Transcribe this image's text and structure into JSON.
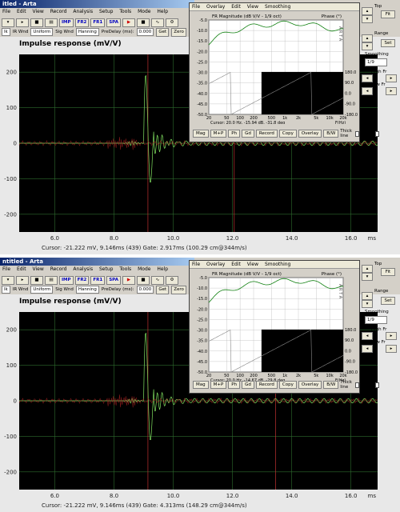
{
  "panels": [
    {
      "window_title": "itled - Arta",
      "menu": [
        "File",
        "Edit",
        "View",
        "Record",
        "Analysis",
        "Setup",
        "Tools",
        "Mode",
        "Help"
      ],
      "toolbar_buttons": [
        "IMP",
        "FR2",
        "FR1",
        "SPA"
      ],
      "toolbar2": {
        "sel0": "lk",
        "ir_wnd_label": "IR Wnd",
        "ir_wnd_value": "Uniform",
        "sig_wnd_label": "Sig Wnd",
        "sig_wnd_value": "Hanning",
        "predelay_label": "PreDelay (ms):",
        "predelay_value": "0.000",
        "get": "Get",
        "zero": "Zero",
        "inv": "Inv"
      },
      "chart_title": "Impulse response (mV/V)",
      "y_ticks": [
        "200",
        "100",
        "0",
        "-100",
        "-200"
      ],
      "x_ticks": [
        "6.0",
        "8.0",
        "10.0",
        "12.0",
        "14.0",
        "16.0"
      ],
      "x_unit": "ms",
      "status": "Cursor: -21.222 mV, 9.146ms (439)  Gate: 2.917ms (100.29 cm@344m/s)",
      "fr": {
        "menu": [
          "File",
          "Overlay",
          "Edit",
          "View",
          "Smoothing"
        ],
        "title": "FR Magnitude (dB V/V - 1/9 oct)",
        "phase_label": "Phase (°)",
        "arta": "A R T A",
        "y_left": [
          "-5.0",
          "-10.0",
          "-15.0",
          "-20.0",
          "-25.0",
          "-30.0",
          "-35.0",
          "-40.0",
          "-45.0",
          "-50.0"
        ],
        "y_right": [
          "180.0",
          "90.0",
          "0.0",
          "-90.0",
          "-180.0"
        ],
        "x_labels": [
          "20",
          "50",
          "100",
          "200",
          "500",
          "1k",
          "2k",
          "5k",
          "10k",
          "20k"
        ],
        "x_unit": "F(Hz)",
        "cursor": "Cursor: 20.0 Hz, -15.94 dB, -31.8 deg",
        "buttons": [
          "Mag",
          "M+P",
          "Ph",
          "Gd",
          "Record",
          "Copy",
          "Overlay",
          "B/W"
        ],
        "thick_line": "Thick line",
        "thick_grid": "Thick grid"
      },
      "side": {
        "top": "Top",
        "fit": "Fit",
        "range": "Range",
        "set": "Set",
        "smoothing": "Smoothing",
        "smoothing_value": "1/9",
        "high_fr": "High Fr",
        "low_fr": "Low Fr"
      }
    },
    {
      "window_title": "ntitled - Arta",
      "menu": [
        "File",
        "Edit",
        "View",
        "Record",
        "Analysis",
        "Setup",
        "Tools",
        "Mode",
        "Help"
      ],
      "toolbar_buttons": [
        "IMP",
        "FR2",
        "FR1",
        "SPA"
      ],
      "toolbar2": {
        "sel0": "lk",
        "ir_wnd_label": "IR Wnd",
        "ir_wnd_value": "Uniform",
        "sig_wnd_label": "Sig Wnd",
        "sig_wnd_value": "Hanning",
        "predelay_label": "PreDelay (ms):",
        "predelay_value": "0.000",
        "get": "Get",
        "zero": "Zero",
        "inv": "Inv"
      },
      "chart_title": "Impulse response (mV/V)",
      "y_ticks": [
        "200",
        "100",
        "0",
        "-100",
        "-200"
      ],
      "x_ticks": [
        "6.0",
        "8.0",
        "10.0",
        "12.0",
        "14.0",
        "16.0"
      ],
      "x_unit": "ms",
      "status": "Cursor: -21.222 mV, 9.146ms (439)  Gate: 4.313ms (148.29 cm@344m/s)",
      "fr": {
        "menu": [
          "File",
          "Overlay",
          "Edit",
          "View",
          "Smoothing"
        ],
        "title": "FR Magnitude (dB V/V - 1/9 oct)",
        "phase_label": "Phase (°)",
        "arta": "A R T A",
        "y_left": [
          "-5.0",
          "-10.0",
          "-15.0",
          "-20.0",
          "-25.0",
          "-30.0",
          "-35.0",
          "-40.0",
          "-45.0",
          "-50.0"
        ],
        "y_right": [
          "180.0",
          "90.0",
          "0.0",
          "-90.0",
          "-180.0"
        ],
        "x_labels": [
          "20",
          "50",
          "100",
          "200",
          "500",
          "1k",
          "2k",
          "5k",
          "10k",
          "20k"
        ],
        "x_unit": "F(Hz)",
        "cursor": "Cursor: 20.0 Hz, -14.67 dB, -29.8 deg",
        "buttons": [
          "Mag",
          "M+P",
          "Ph",
          "Gd",
          "Record",
          "Copy",
          "Overlay",
          "B/W"
        ],
        "thick_line": "Thick line",
        "thick_grid": "Thick grid"
      },
      "side": {
        "top": "Top",
        "fit": "Fit",
        "range": "Range",
        "set": "Set",
        "smoothing": "Smoothing",
        "smoothing_value": "1/9",
        "high_fr": "High Fr",
        "low_fr": "Low Fr"
      }
    }
  ],
  "colors": {
    "plot_bg": "#000000",
    "grid": "#2e6b2e",
    "trace_green": "#80e060",
    "trace_red": "#a02020",
    "cursor": "#c03030",
    "fr_mag": "#108010",
    "fr_phase": "#ffffff"
  }
}
